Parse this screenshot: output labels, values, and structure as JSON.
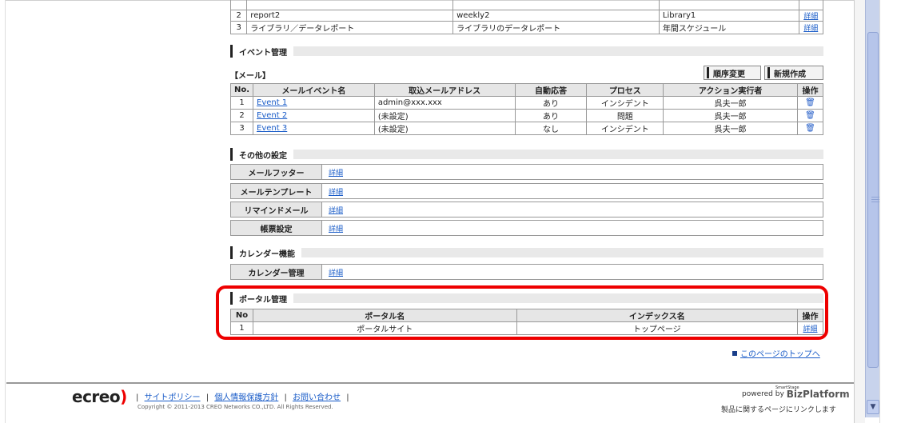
{
  "report_table": {
    "rows": [
      {
        "no": "2",
        "name": "report2",
        "schedule": "weekly2",
        "library": "Library1",
        "action": "詳細"
      },
      {
        "no": "3",
        "name": "ライブラリ／データレポート",
        "schedule": "ライブラリのデータレポート",
        "library": "年間スケジュール",
        "action": "詳細"
      }
    ]
  },
  "event_section": {
    "title": "イベント管理"
  },
  "mail": {
    "label": "【メール】",
    "buttons": {
      "reorder": "順序変更",
      "create": "新規作成"
    },
    "headers": [
      "No.",
      "メールイベント名",
      "取込メールアドレス",
      "自動応答",
      "プロセス",
      "アクション実行者",
      "操作"
    ],
    "rows": [
      {
        "no": "1",
        "name": "Event 1",
        "address": "admin@xxx.xxx",
        "auto": "あり",
        "process": "インシデント",
        "actor": "呉夫一郎",
        "op": "trash-icon"
      },
      {
        "no": "2",
        "name": "Event 2",
        "address": "(未設定)",
        "auto": "あり",
        "process": "問題",
        "actor": "呉夫一郎",
        "op": "trash-icon"
      },
      {
        "no": "3",
        "name": "Event 3",
        "address": "(未設定)",
        "auto": "なし",
        "process": "インシデント",
        "actor": "呉夫一郎",
        "op": "trash-icon"
      }
    ]
  },
  "other_settings": {
    "title": "その他の設定",
    "rows": [
      {
        "label": "メールフッター",
        "value": "詳細"
      },
      {
        "label": "メールテンプレート",
        "value": "詳細"
      },
      {
        "label": "リマインドメール",
        "value": "詳細"
      },
      {
        "label": "帳票設定",
        "value": "詳細"
      }
    ]
  },
  "calendar": {
    "title": "カレンダー機能",
    "rows": [
      {
        "label": "カレンダー管理",
        "value": "詳細"
      }
    ]
  },
  "portal": {
    "title": "ポータル管理",
    "headers": [
      "No",
      "ポータル名",
      "インデックス名",
      "操作"
    ],
    "rows": [
      {
        "no": "1",
        "name": "ポータルサイト",
        "index": "トップページ",
        "op": "詳細"
      }
    ]
  },
  "page_top_link": "このページのトップへ",
  "footer": {
    "logo_text": "ecreo",
    "links": [
      "サイトポリシー",
      "個人情報保護方針",
      "お問い合わせ"
    ],
    "copyright": "Copyright © 2011-2013 CREO Networks CO.,LTD. All Rights Reserved.",
    "powered_by": "powered by",
    "product": "BizPlatform",
    "product_sub": "SmartStage",
    "product_link": "製品に関するページにリンクします"
  },
  "colors": {
    "highlight": "#e00000",
    "link": "#1a5cc8",
    "header_bg": "#e6e6e6"
  }
}
